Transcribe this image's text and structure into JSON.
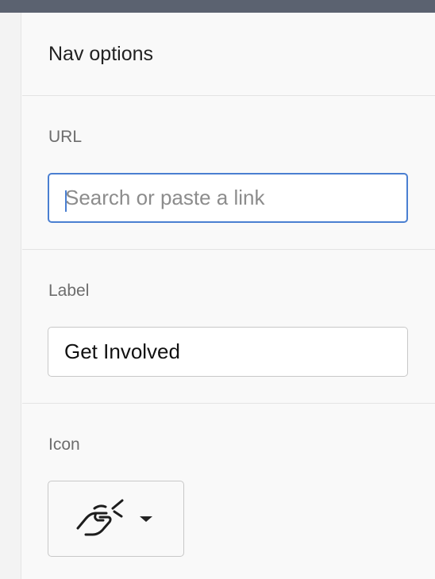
{
  "panel": {
    "title": "Nav options"
  },
  "url_field": {
    "label": "URL",
    "placeholder": "Search or paste a link",
    "value": ""
  },
  "label_field": {
    "label": "Label",
    "value": "Get Involved"
  },
  "icon_field": {
    "label": "Icon",
    "selected_icon": "handshake-icon",
    "dropdown_icon": "chevron-down-icon"
  },
  "colors": {
    "topbar": "#5b6270",
    "focus_border": "#4a7fd1",
    "panel_background": "#f9f9f9"
  }
}
